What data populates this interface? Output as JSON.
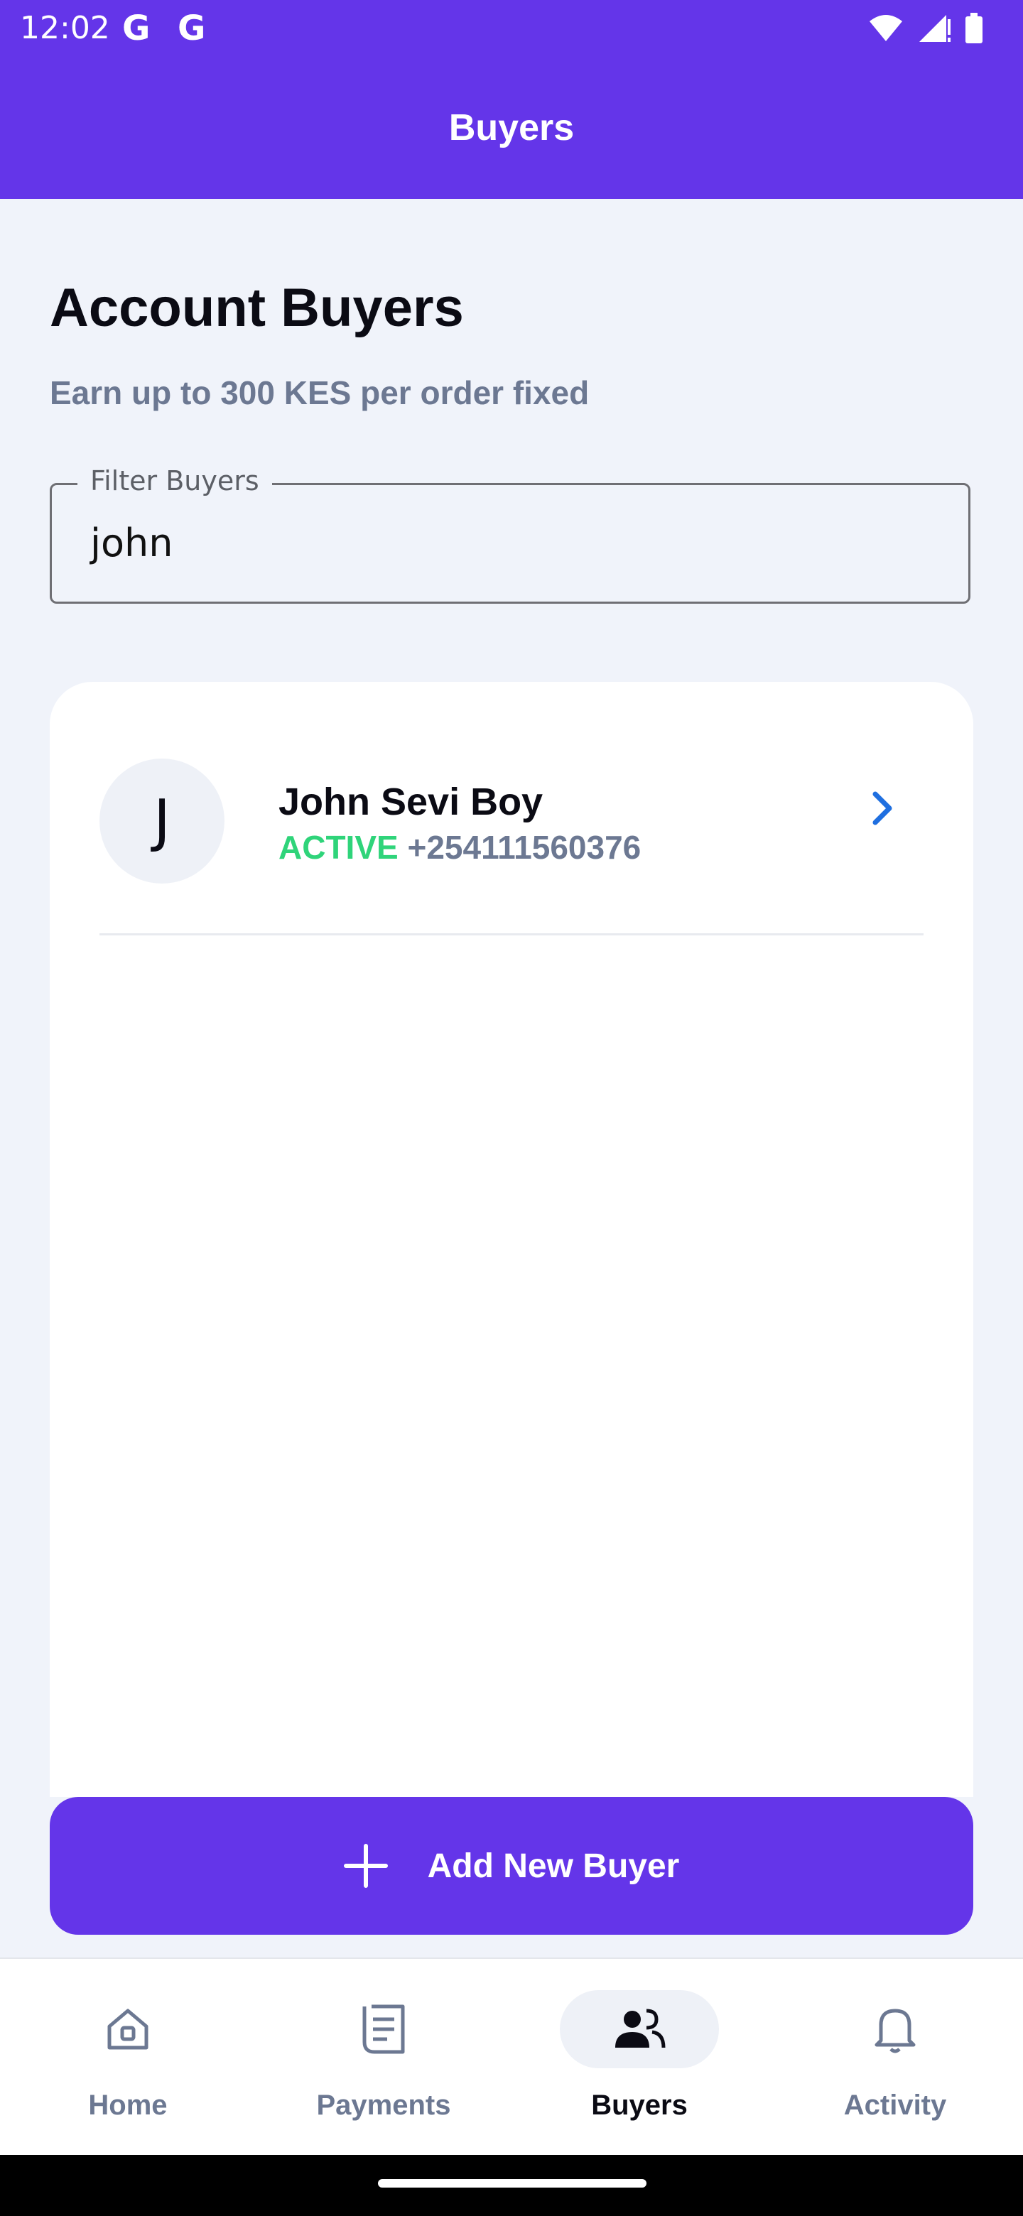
{
  "status_bar": {
    "time": "12:02",
    "notification_icons": [
      "G",
      "G"
    ]
  },
  "app_bar": {
    "title": "Buyers"
  },
  "header": {
    "title": "Account Buyers",
    "subtitle": "Earn up to 300 KES per order fixed"
  },
  "filter": {
    "label": "Filter Buyers",
    "value": "john"
  },
  "buyers": [
    {
      "initial": "J",
      "name": "John Sevi Boy",
      "status": "ACTIVE",
      "phone": "+254111560376"
    }
  ],
  "add_button": {
    "label": "Add New Buyer"
  },
  "bottom_nav": {
    "items": [
      {
        "label": "Home",
        "icon": "home-icon",
        "active": false
      },
      {
        "label": "Payments",
        "icon": "receipt-icon",
        "active": false
      },
      {
        "label": "Buyers",
        "icon": "people-icon",
        "active": true
      },
      {
        "label": "Activity",
        "icon": "bell-icon",
        "active": false
      }
    ]
  },
  "colors": {
    "primary": "#6435e9",
    "active_status": "#2fd47a",
    "muted_text": "#6c7892",
    "chevron": "#1f6fe0"
  }
}
